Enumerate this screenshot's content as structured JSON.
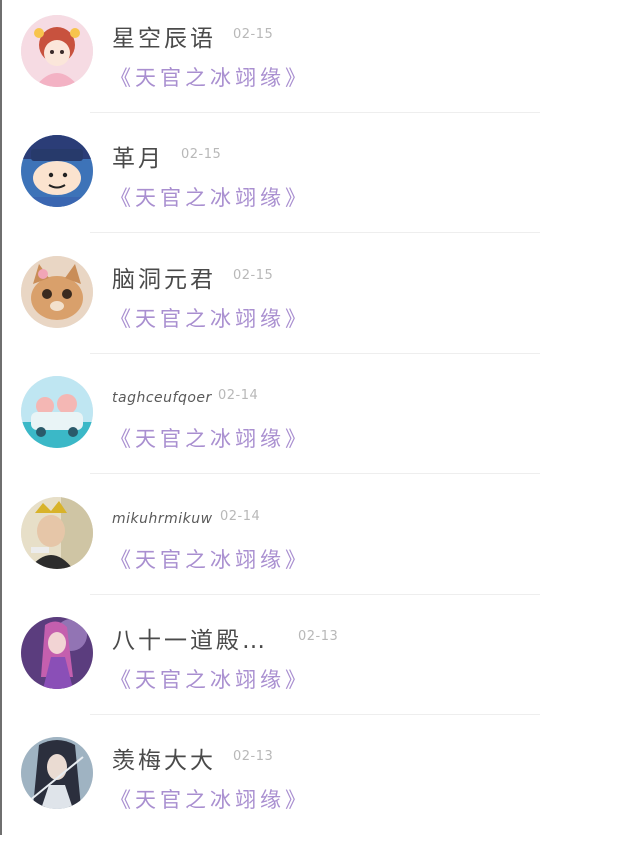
{
  "items": [
    {
      "name": "星空辰语",
      "date": "02-15",
      "subtitle": "《天官之冰翊缘》",
      "avatar_icon": "girl-doll-avatar-icon"
    },
    {
      "name": "革月",
      "date": "02-15",
      "subtitle": "《天官之冰翊缘》",
      "avatar_icon": "cartoon-boy-police-avatar-icon"
    },
    {
      "name": "脑洞元君",
      "date": "02-15",
      "subtitle": "《天官之冰翊缘》",
      "avatar_icon": "cat-avatar-icon"
    },
    {
      "name": "taghceufqoer",
      "date": "02-14",
      "subtitle": "《天官之冰翊缘》",
      "avatar_icon": "cartoon-car-avatar-icon"
    },
    {
      "name": "mikuhrmikuw",
      "date": "02-14",
      "subtitle": "《天官之冰翊缘》",
      "avatar_icon": "child-crown-avatar-icon"
    },
    {
      "name": "八十一道殿…",
      "date": "02-13",
      "subtitle": "《天官之冰翊缘》",
      "avatar_icon": "anime-girl-purple-avatar-icon"
    },
    {
      "name": "羡梅大大",
      "date": "02-13",
      "subtitle": "《天官之冰翊缘》",
      "avatar_icon": "ancient-swordsman-avatar-icon"
    }
  ],
  "colors": {
    "subtitle": "#a98fd0",
    "name": "#4a4a4a",
    "date": "#b8b8b8"
  }
}
